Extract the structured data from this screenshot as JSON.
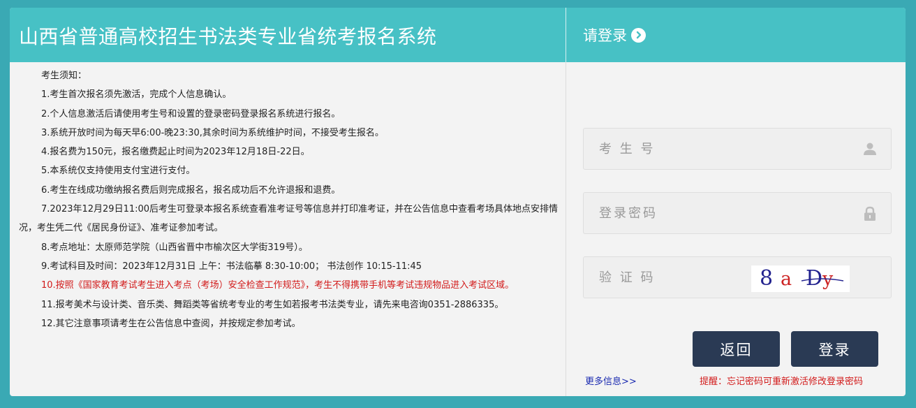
{
  "header": {
    "title": "山西省普通高校招生书法类专业省统考报名系统",
    "login_title": "请登录"
  },
  "notice": {
    "heading": "考生须知：",
    "items": [
      "1.考生首次报名须先激活，完成个人信息确认。",
      "2.个人信息激活后请使用考生号和设置的登录密码登录报名系统进行报名。",
      "3.系统开放时间为每天早6:00-晚23:30,其余时间为系统维护时间，不接受考生报名。",
      "4.报名费为150元，报名缴费起止时间为2023年12月18日-22日。",
      "5.本系统仅支持使用支付宝进行支付。",
      "6.考生在线成功缴纳报名费后则完成报名，报名成功后不允许退报和退费。",
      "7.2023年12月29日11:00后考生可登录本报名系统查看准考证号等信息并打印准考证，并在公告信息中查看考场具体地点安排情况，考生凭二代《居民身份证》、准考证参加考试。",
      "8.考点地址：太原师范学院（山西省晋中市榆次区大学街319号）。",
      "9.考试科目及时间：2023年12月31日 上午：书法临摹 8:30-10:00； 书法创作 10:15-11:45",
      "10.按照《国家教育考试考生进入考点（考场）安全检查工作规范》，考生不得携带手机等考试违规物品进入考试区域。",
      "11.报考美术与设计类、音乐类、舞蹈类等省统考专业的考生如若报考书法类专业，请先来电咨询0351-2886335。",
      "12.其它注意事项请考生在公告信息中查阅，并按规定参加考试。"
    ]
  },
  "login": {
    "student_id_placeholder": "考 生 号",
    "password_placeholder": "登录密码",
    "captcha_placeholder": "验 证 码",
    "captcha_chars": [
      "8",
      "a",
      "D",
      "y"
    ],
    "back_label": "返回",
    "login_label": "登录",
    "more_info": "更多信息>>",
    "reminder": "提醒：忘记密码可重新激活修改登录密码"
  },
  "colors": {
    "background": "#3aa9b4",
    "header": "#47c1c5",
    "button": "#2a3a54",
    "warning": "#d21a1a",
    "link": "#1a2ab0"
  }
}
